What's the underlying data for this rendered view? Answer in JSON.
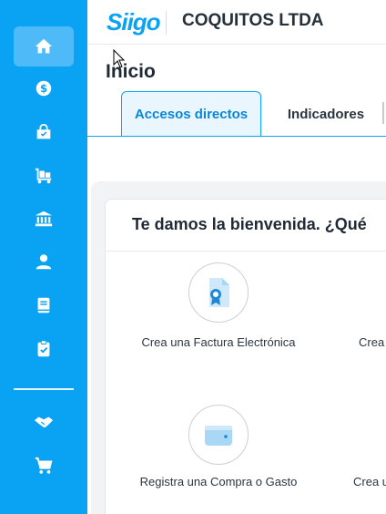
{
  "sidebar": {
    "items": [
      {
        "name": "home",
        "active": true
      },
      {
        "name": "dollar"
      },
      {
        "name": "shopping-bag"
      },
      {
        "name": "cart-delivery"
      },
      {
        "name": "bank"
      },
      {
        "name": "user"
      },
      {
        "name": "book"
      },
      {
        "name": "clipboard-check"
      },
      {
        "name": "handshake"
      },
      {
        "name": "shopping-cart"
      }
    ]
  },
  "header": {
    "logo_text": "Siigo",
    "company": "COQUITOS LTDA"
  },
  "page": {
    "title": "Inicio",
    "tabs": [
      {
        "label": "Accesos directos",
        "active": true
      },
      {
        "label": "Indicadores"
      }
    ]
  },
  "card": {
    "welcome": "Te damos la bienvenida. ¿Qué",
    "shortcuts": [
      {
        "label": "Crea una Factura Electrónica",
        "icon": "invoice-icon"
      },
      {
        "label": "Crea",
        "icon": ""
      },
      {
        "label": "Registra una Compra o Gasto",
        "icon": "wallet-icon"
      },
      {
        "label": "Crea u",
        "icon": ""
      }
    ]
  },
  "colors": {
    "brand": "#0aa2f3",
    "sidebar_active": "#4ebaf7"
  }
}
